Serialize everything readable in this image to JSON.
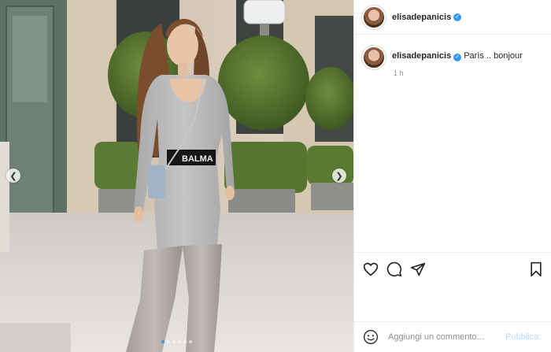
{
  "post": {
    "username": "elisadepanicis",
    "verified_icon": "verified-badge-icon",
    "caption": "Parìs .. bonjour",
    "time_ago": "1 h",
    "image_belt_text": "BALMA",
    "carousel": {
      "total_slides": 6,
      "active_index": 0
    }
  },
  "actions": {
    "like_icon": "heart-icon",
    "comment_icon": "comment-icon",
    "share_icon": "send-icon",
    "save_icon": "bookmark-icon"
  },
  "comment": {
    "placeholder": "Aggiungi un commento...",
    "publish_label": "Pubblica",
    "emoji_icon": "smiley-icon"
  },
  "colors": {
    "accent_blue": "#3897f0",
    "publish_disabled": "#b3dbff",
    "border": "#efefef"
  }
}
